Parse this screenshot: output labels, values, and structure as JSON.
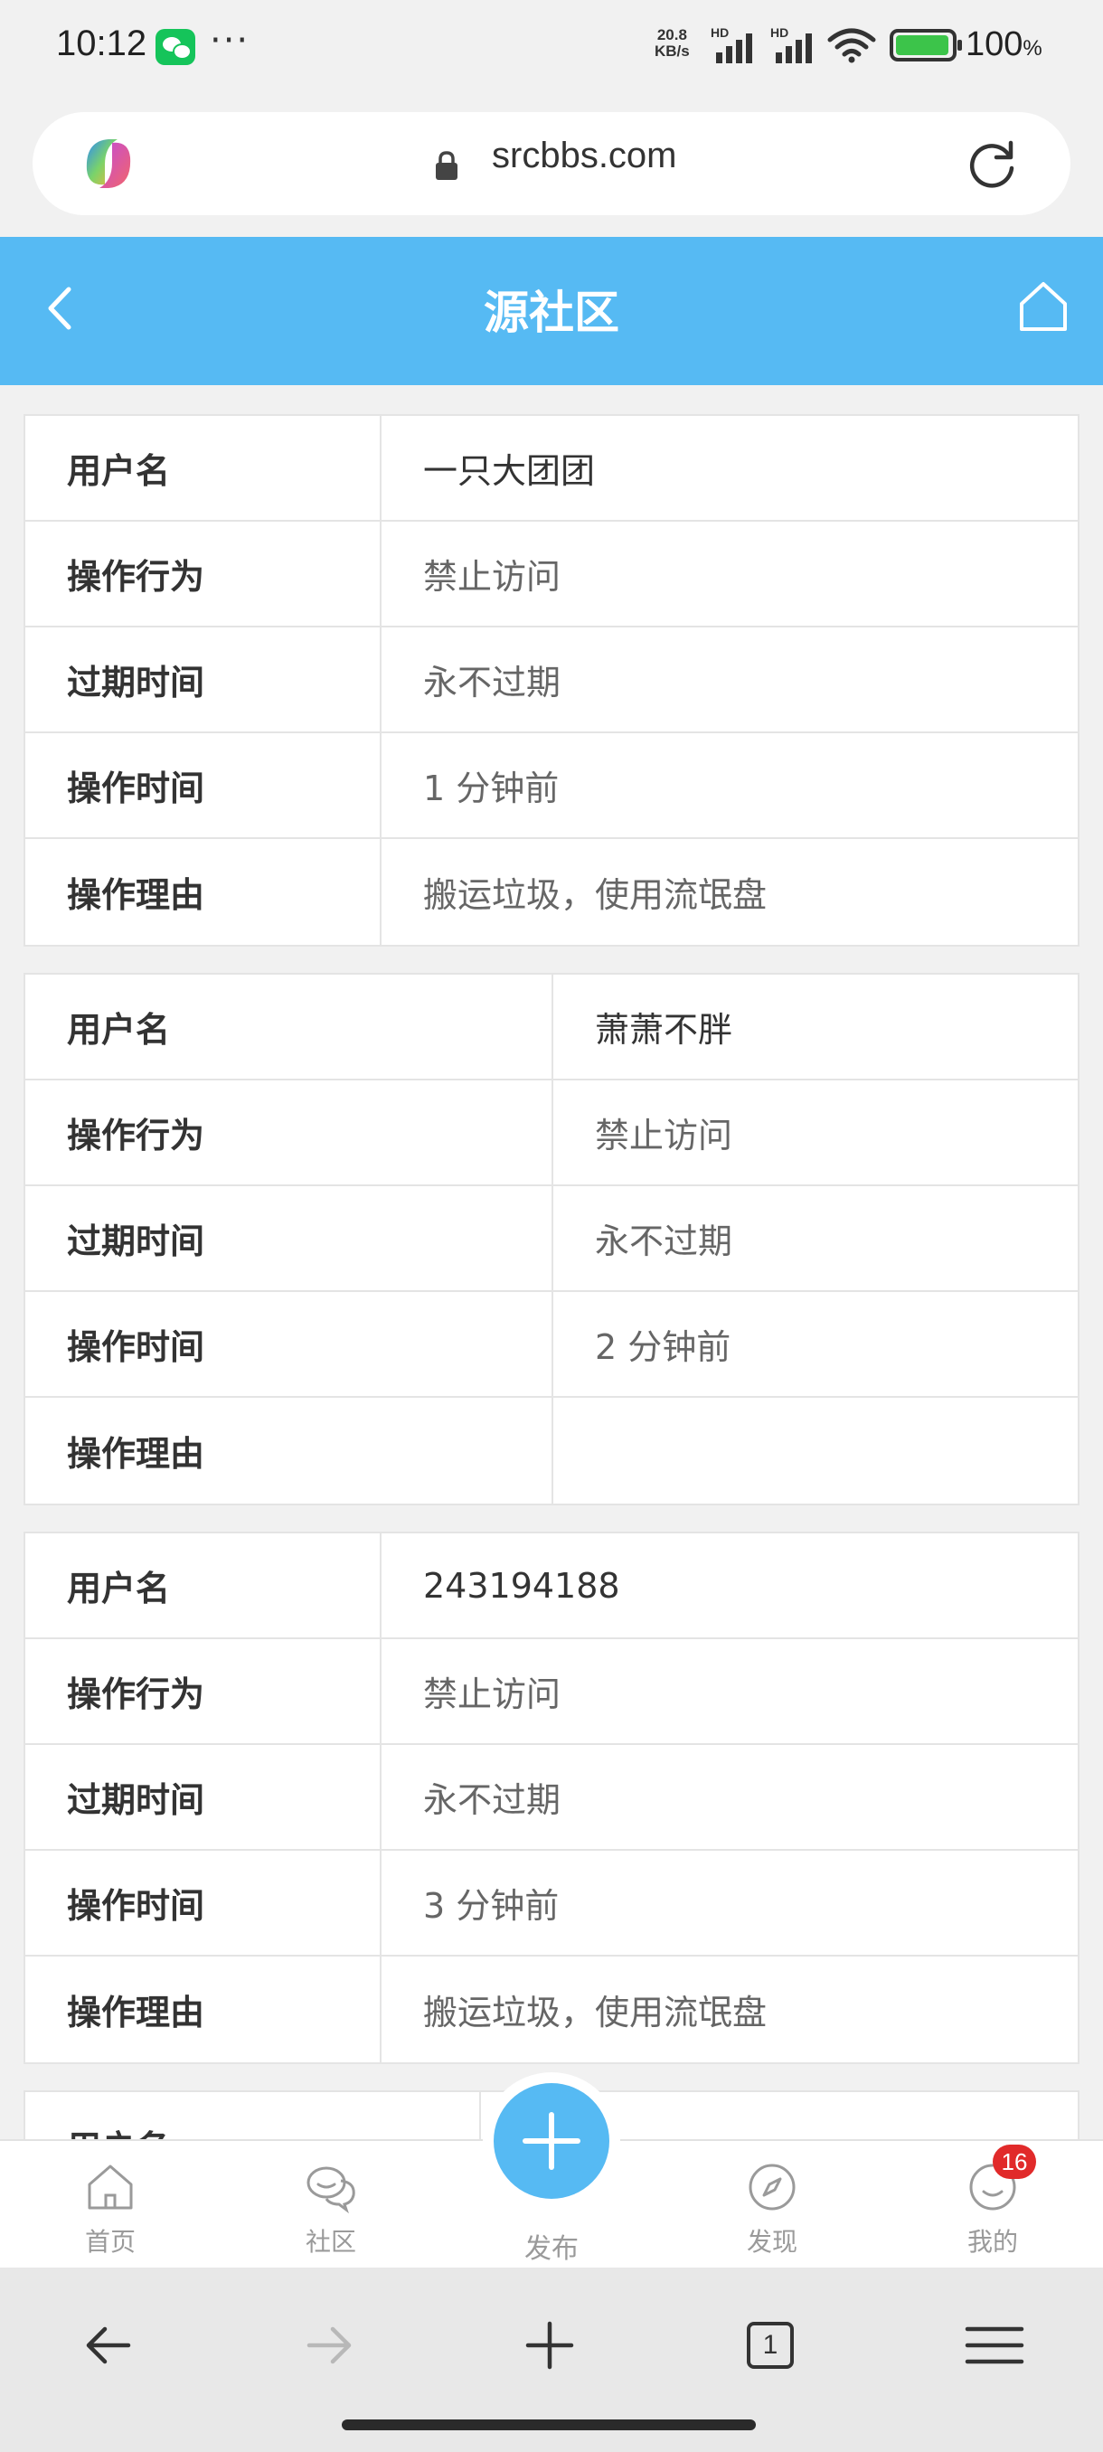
{
  "status_bar": {
    "time": "10:12",
    "net_speed_value": "20.8",
    "net_speed_unit": "KB/s",
    "signal_label_1": "HD",
    "signal_label_2": "HD",
    "battery_percent": "100",
    "battery_unit": "%",
    "icons": [
      "wechat-icon",
      "more-dots-icon",
      "signal-icon",
      "wifi-icon",
      "battery-charging-icon"
    ]
  },
  "browser": {
    "url": "srcbbs.com",
    "icons": [
      "copilot-logo",
      "lock-icon",
      "reload-icon"
    ]
  },
  "header": {
    "title": "源社区",
    "icons": [
      "back-icon",
      "home-icon"
    ]
  },
  "cards": [
    {
      "rows": [
        {
          "label": "用户名",
          "value": "一只大团团"
        },
        {
          "label": "操作行为",
          "value": "禁止访问"
        },
        {
          "label": "过期时间",
          "value": "永不过期"
        },
        {
          "label": "操作时间",
          "value": "1 分钟前"
        },
        {
          "label": "操作理由",
          "value": "搬运垃圾，使用流氓盘"
        }
      ]
    },
    {
      "rows": [
        {
          "label": "用户名",
          "value": "萧萧不胖"
        },
        {
          "label": "操作行为",
          "value": "禁止访问"
        },
        {
          "label": "过期时间",
          "value": "永不过期"
        },
        {
          "label": "操作时间",
          "value": "2 分钟前"
        },
        {
          "label": "操作理由",
          "value": ""
        }
      ]
    },
    {
      "rows": [
        {
          "label": "用户名",
          "value": "243194188"
        },
        {
          "label": "操作行为",
          "value": "禁止访问"
        },
        {
          "label": "过期时间",
          "value": "永不过期"
        },
        {
          "label": "操作时间",
          "value": "3 分钟前"
        },
        {
          "label": "操作理由",
          "value": "搬运垃圾，使用流氓盘"
        }
      ]
    },
    {
      "rows": [
        {
          "label": "用户名",
          "value": ""
        }
      ]
    }
  ],
  "bottom_nav": {
    "home": "首页",
    "community": "社区",
    "publish": "发布",
    "discover": "发现",
    "mine": "我的",
    "mine_badge": "16",
    "icons": [
      "home-icon",
      "chat-icon",
      "plus-icon",
      "compass-icon",
      "smile-icon"
    ]
  },
  "browser_toolbar": {
    "tab_count": "1",
    "icons": [
      "back-arrow-icon",
      "forward-arrow-icon",
      "new-tab-icon",
      "tabs-icon",
      "menu-icon"
    ]
  },
  "colors": {
    "accent": "#56baf3",
    "badge": "#e12a2a",
    "label_text": "#333333",
    "value_text": "#666666"
  }
}
